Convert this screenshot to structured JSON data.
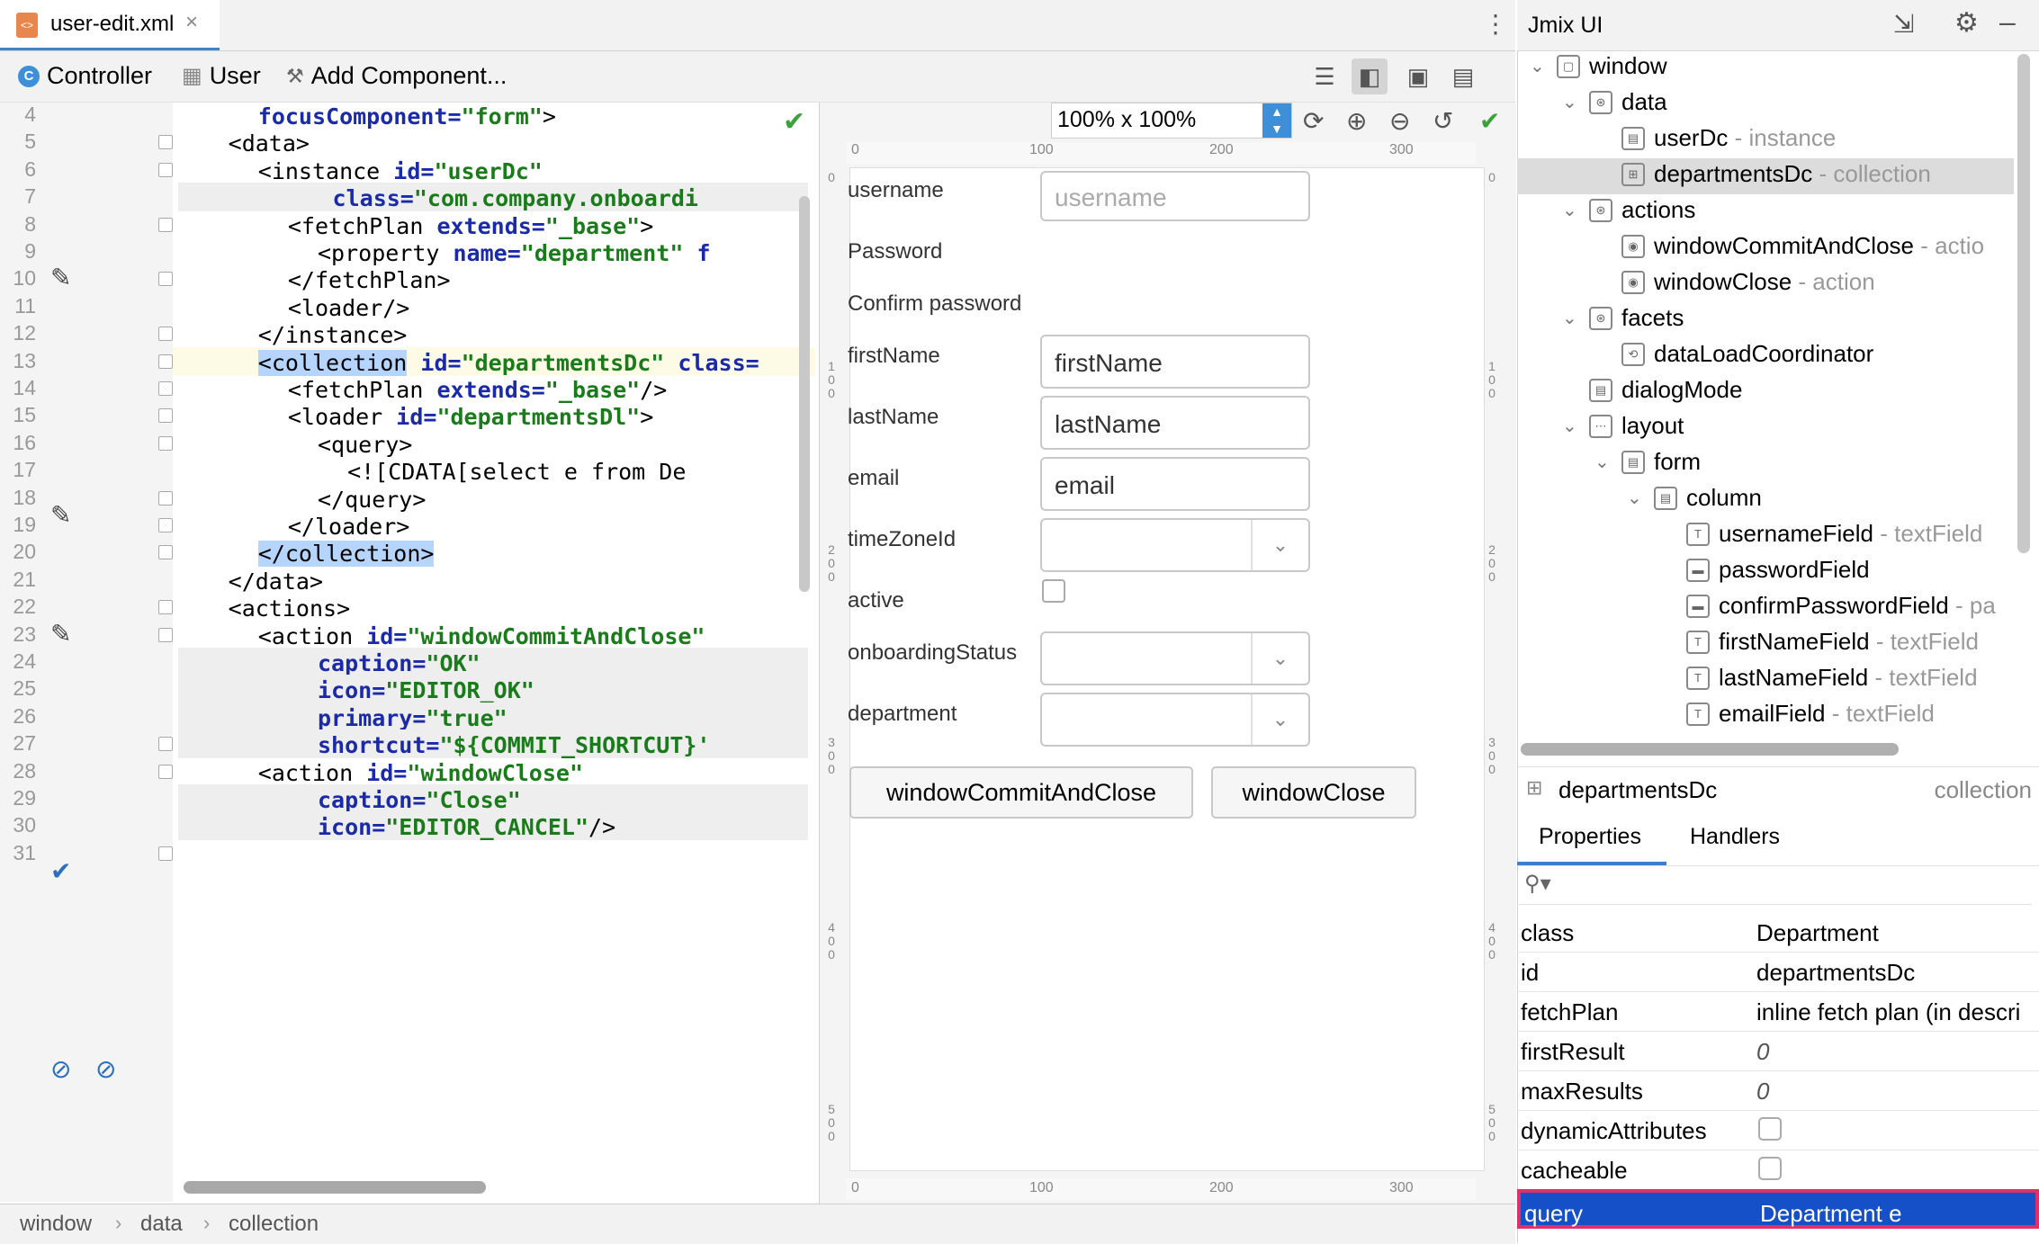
{
  "tab": {
    "title": "user-edit.xml",
    "close": "×"
  },
  "toolbar": {
    "controller": "Controller",
    "user": "User",
    "add_component": "Add Component..."
  },
  "editor": {
    "lines": [
      {
        "n": "4",
        "tokens": [
          [
            "attr",
            "focusComponent="
          ],
          [
            "val",
            "\"form\""
          ],
          [
            "tag",
            ">"
          ]
        ],
        "indent": 5
      },
      {
        "n": "5",
        "tokens": [
          [
            "tag",
            "<data>"
          ]
        ],
        "indent": 3
      },
      {
        "n": "6",
        "tokens": [
          [
            "tag",
            "<instance "
          ],
          [
            "attr",
            "id="
          ],
          [
            "val",
            "\"userDc\""
          ]
        ],
        "indent": 5
      },
      {
        "n": "7",
        "tokens": [
          [
            "attr",
            "class="
          ],
          [
            "val",
            "\"com.company.onboardi"
          ]
        ],
        "indent": 10
      },
      {
        "n": "8",
        "tokens": [
          [
            "tag",
            "<fetchPlan "
          ],
          [
            "attr",
            "extends="
          ],
          [
            "val",
            "\"_base\""
          ],
          [
            "tag",
            ">"
          ]
        ],
        "indent": 7
      },
      {
        "n": "9",
        "tokens": [
          [
            "tag",
            "<property "
          ],
          [
            "attr",
            "name="
          ],
          [
            "val",
            "\"department\" "
          ],
          [
            "attr",
            "f"
          ]
        ],
        "indent": 9
      },
      {
        "n": "10",
        "tokens": [
          [
            "tag",
            "</fetchPlan>"
          ]
        ],
        "indent": 7
      },
      {
        "n": "11",
        "tokens": [
          [
            "tag",
            "<loader/>"
          ]
        ],
        "indent": 7
      },
      {
        "n": "12",
        "tokens": [
          [
            "tag",
            "</instance>"
          ]
        ],
        "indent": 5
      },
      {
        "n": "13",
        "tokens": [
          [
            "hl",
            "<collection"
          ],
          [
            "tag",
            " "
          ],
          [
            "attr",
            "id="
          ],
          [
            "val",
            "\"departmentsDc\" "
          ],
          [
            "attr",
            "class="
          ]
        ],
        "indent": 5
      },
      {
        "n": "14",
        "tokens": [
          [
            "tag",
            "<fetchPlan "
          ],
          [
            "attr",
            "extends="
          ],
          [
            "val",
            "\"_base\""
          ],
          [
            "tag",
            "/>"
          ]
        ],
        "indent": 7
      },
      {
        "n": "15",
        "tokens": [
          [
            "tag",
            "<loader "
          ],
          [
            "attr",
            "id="
          ],
          [
            "val",
            "\"departmentsDl\""
          ],
          [
            "tag",
            ">"
          ]
        ],
        "indent": 7
      },
      {
        "n": "16",
        "tokens": [
          [
            "tag",
            "<query>"
          ]
        ],
        "indent": 9
      },
      {
        "n": "17",
        "tokens": [
          [
            "tag",
            "<![CDATA[select e from De"
          ]
        ],
        "indent": 11
      },
      {
        "n": "18",
        "tokens": [
          [
            "tag",
            "</query>"
          ]
        ],
        "indent": 9
      },
      {
        "n": "19",
        "tokens": [
          [
            "tag",
            "</loader>"
          ]
        ],
        "indent": 7
      },
      {
        "n": "20",
        "tokens": [
          [
            "hl",
            "</collection>"
          ]
        ],
        "indent": 5
      },
      {
        "n": "21",
        "tokens": [
          [
            "tag",
            "</data>"
          ]
        ],
        "indent": 3
      },
      {
        "n": "22",
        "tokens": [
          [
            "tag",
            "<actions>"
          ]
        ],
        "indent": 3
      },
      {
        "n": "23",
        "tokens": [
          [
            "tag",
            "<action "
          ],
          [
            "attr",
            "id="
          ],
          [
            "val",
            "\"windowCommitAndClose\""
          ]
        ],
        "indent": 5
      },
      {
        "n": "24",
        "tokens": [
          [
            "attr",
            "caption="
          ],
          [
            "val",
            "\"OK\""
          ]
        ],
        "indent": 9
      },
      {
        "n": "25",
        "tokens": [
          [
            "attr",
            "icon="
          ],
          [
            "val",
            "\"EDITOR_OK\""
          ]
        ],
        "indent": 9
      },
      {
        "n": "26",
        "tokens": [
          [
            "attr",
            "primary="
          ],
          [
            "val",
            "\"true\""
          ]
        ],
        "indent": 9
      },
      {
        "n": "27",
        "tokens": [
          [
            "attr",
            "shortcut="
          ],
          [
            "val",
            "\"${COMMIT_SHORTCUT}'"
          ]
        ],
        "indent": 9
      },
      {
        "n": "28",
        "tokens": [
          [
            "tag",
            "<action "
          ],
          [
            "attr",
            "id="
          ],
          [
            "val",
            "\"windowClose\""
          ]
        ],
        "indent": 5
      },
      {
        "n": "29",
        "tokens": [
          [
            "attr",
            "caption="
          ],
          [
            "val",
            "\"Close\""
          ]
        ],
        "indent": 9
      },
      {
        "n": "30",
        "tokens": [
          [
            "attr",
            "icon="
          ],
          [
            "val",
            "\"EDITOR_CANCEL\""
          ],
          [
            "tag",
            "/>"
          ]
        ],
        "indent": 9
      },
      {
        "n": "31",
        "tokens": [],
        "indent": 5
      }
    ]
  },
  "breadcrumb": [
    "window",
    "data",
    "collection"
  ],
  "designer": {
    "zoom": "100% x 100%",
    "ruler_top": [
      "0",
      "100",
      "200",
      "300"
    ],
    "ruler_left": [
      "0",
      "1 0 0",
      "2 0 0",
      "3 0 0",
      "4 0 0",
      "5 0 0"
    ],
    "labels": [
      "username",
      "Password",
      "Confirm password",
      "firstName",
      "lastName",
      "email",
      "timeZoneId",
      "active",
      "onboardingStatus",
      "department"
    ],
    "fields": {
      "username": "username",
      "firstName": "firstName",
      "lastName": "lastName",
      "email": "email"
    },
    "buttons": [
      "windowCommitAndClose",
      "windowClose"
    ]
  },
  "panel": {
    "title": "Jmix UI",
    "tree": [
      {
        "label": "window",
        "sub": "",
        "level": 0,
        "chev": "⌄"
      },
      {
        "label": "data",
        "sub": "",
        "level": 1,
        "chev": "⌄"
      },
      {
        "label": "userDc",
        "sub": " - instance",
        "level": 2,
        "chev": ""
      },
      {
        "label": "departmentsDc",
        "sub": " - collection",
        "level": 2,
        "chev": ""
      },
      {
        "label": "actions",
        "sub": "",
        "level": 1,
        "chev": "⌄"
      },
      {
        "label": "windowCommitAndClose",
        "sub": " - actio",
        "level": 2,
        "chev": ""
      },
      {
        "label": "windowClose",
        "sub": " - action",
        "level": 2,
        "chev": ""
      },
      {
        "label": "facets",
        "sub": "",
        "level": 1,
        "chev": "⌄"
      },
      {
        "label": "dataLoadCoordinator",
        "sub": "",
        "level": 2,
        "chev": ""
      },
      {
        "label": "dialogMode",
        "sub": "",
        "level": 1,
        "chev": ""
      },
      {
        "label": "layout",
        "sub": "",
        "level": 1,
        "chev": "⌄"
      },
      {
        "label": "form",
        "sub": "",
        "level": 2,
        "chev": "⌄"
      },
      {
        "label": "column",
        "sub": "",
        "level": 3,
        "chev": "⌄"
      },
      {
        "label": "usernameField",
        "sub": " - textField",
        "level": 4,
        "chev": ""
      },
      {
        "label": "passwordField",
        "sub": "",
        "level": 4,
        "chev": ""
      },
      {
        "label": "confirmPasswordField",
        "sub": " - pa",
        "level": 4,
        "chev": ""
      },
      {
        "label": "firstNameField",
        "sub": " - textField",
        "level": 4,
        "chev": ""
      },
      {
        "label": "lastNameField",
        "sub": " - textField",
        "level": 4,
        "chev": ""
      },
      {
        "label": "emailField",
        "sub": " - textField",
        "level": 4,
        "chev": ""
      }
    ],
    "selected": {
      "name": "departmentsDc",
      "type": "collection"
    },
    "tabs": [
      "Properties",
      "Handlers"
    ],
    "props": [
      {
        "k": "class",
        "v": "Department",
        "kind": "text"
      },
      {
        "k": "id",
        "v": "departmentsDc",
        "kind": "text"
      },
      {
        "k": "fetchPlan",
        "v": "inline fetch plan (in descri",
        "kind": "text"
      },
      {
        "k": "firstResult",
        "v": "0",
        "kind": "italic"
      },
      {
        "k": "maxResults",
        "v": "0",
        "kind": "italic"
      },
      {
        "k": "dynamicAttributes",
        "v": "",
        "kind": "check"
      },
      {
        "k": "cacheable",
        "v": "",
        "kind": "check"
      },
      {
        "k": "query",
        "v": "Department e",
        "kind": "selected"
      }
    ]
  }
}
